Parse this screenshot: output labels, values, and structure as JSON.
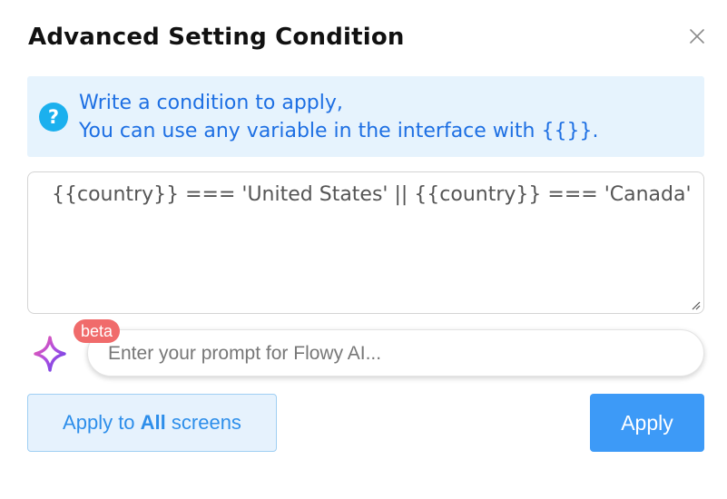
{
  "dialog": {
    "title": "Advanced Setting Condition",
    "close_icon": "close-icon"
  },
  "info": {
    "icon": "question-icon",
    "icon_glyph": "?",
    "line1": "Write a condition to apply,",
    "line2": "You can use any variable in the interface with {{}}.",
    "background_color": "#e6f3fd",
    "text_color": "#1d6fe3"
  },
  "condition": {
    "value": "{{country}} === 'United States' || {{country}} === 'Canada'"
  },
  "ai_prompt": {
    "icon": "sparkle-icon",
    "badge": "beta",
    "placeholder": "Enter your prompt for Flowy AI..."
  },
  "buttons": {
    "apply_all_prefix": "Apply to ",
    "apply_all_bold": "All",
    "apply_all_suffix": " screens",
    "apply_label": "Apply",
    "apply_color": "#3d9af7"
  }
}
